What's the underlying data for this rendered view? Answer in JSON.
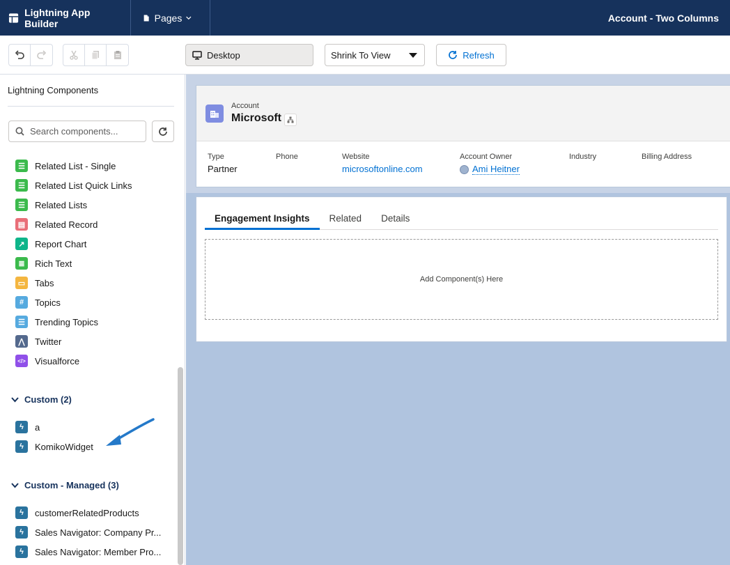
{
  "topbar": {
    "app_title": "Lightning App Builder",
    "pages_label": "Pages",
    "page_name": "Account - Two Columns"
  },
  "toolbar": {
    "device_label": "Desktop",
    "zoom_value": "Shrink To View",
    "refresh_label": "Refresh"
  },
  "panel": {
    "title": "Lightning Components",
    "search_placeholder": "Search components...",
    "standard_items": [
      {
        "label": "Related List - Single",
        "icon": "related-list-icon",
        "color": "#3bba4c"
      },
      {
        "label": "Related List Quick Links",
        "icon": "related-list-icon",
        "color": "#3bba4c"
      },
      {
        "label": "Related Lists",
        "icon": "related-list-icon",
        "color": "#3bba4c"
      },
      {
        "label": "Related Record",
        "icon": "record-icon",
        "color": "#e96e78"
      },
      {
        "label": "Report Chart",
        "icon": "chart-icon",
        "color": "#0eb58a"
      },
      {
        "label": "Rich Text",
        "icon": "rich-text-icon",
        "color": "#3bba4c"
      },
      {
        "label": "Tabs",
        "icon": "tabs-icon",
        "color": "#f4b640"
      },
      {
        "label": "Topics",
        "icon": "hash-icon",
        "color": "#56aadf"
      },
      {
        "label": "Trending Topics",
        "icon": "list-icon",
        "color": "#56aadf"
      },
      {
        "label": "Twitter",
        "icon": "twitter-icon",
        "color": "#54698d"
      },
      {
        "label": "Visualforce",
        "icon": "code-icon",
        "color": "#9050e9"
      }
    ],
    "custom_section": "Custom (2)",
    "custom_items": [
      {
        "label": "a",
        "icon": "lightning-icon",
        "color": "#2a739e"
      },
      {
        "label": "KomikoWidget",
        "icon": "lightning-icon",
        "color": "#2a739e"
      }
    ],
    "managed_section": "Custom - Managed (3)",
    "managed_items": [
      {
        "label": "customerRelatedProducts",
        "icon": "lightning-icon",
        "color": "#2a739e"
      },
      {
        "label": "Sales Navigator: Company Pr...",
        "icon": "lightning-icon",
        "color": "#2a739e"
      },
      {
        "label": "Sales Navigator: Member Pro...",
        "icon": "lightning-icon",
        "color": "#2a739e"
      }
    ]
  },
  "record": {
    "object_type": "Account",
    "name": "Microsoft",
    "fields": [
      {
        "label": "Type",
        "value": "Partner",
        "link": false
      },
      {
        "label": "Phone",
        "value": "",
        "link": false
      },
      {
        "label": "Website",
        "value": "microsoftonline.com",
        "link": true
      },
      {
        "label": "Account Owner",
        "value": "Ami Heitner",
        "link": true
      },
      {
        "label": "Industry",
        "value": "",
        "link": false
      },
      {
        "label": "Billing Address",
        "value": "",
        "link": false
      }
    ]
  },
  "tabs": {
    "items": [
      "Engagement Insights",
      "Related",
      "Details"
    ],
    "active_index": 0,
    "dropzone_label": "Add Component(s) Here"
  },
  "colors": {
    "header_bg": "#16325c",
    "accent": "#0070d2",
    "canvas_bg": "#b0c4df"
  }
}
